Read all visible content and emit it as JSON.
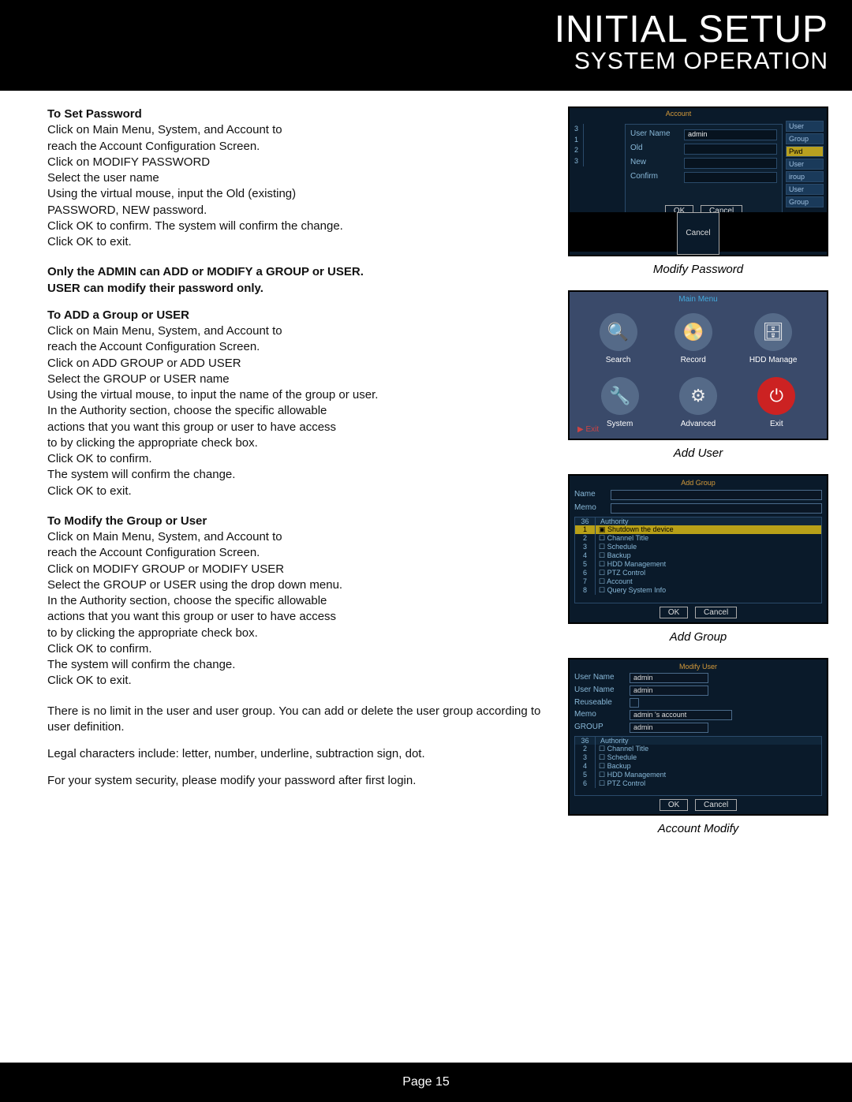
{
  "header": {
    "title": "INITIAL SETUP",
    "subtitle": "SYSTEM OPERATION"
  },
  "footer": {
    "page_label": "Page  15"
  },
  "captions": {
    "modify_password": "Modify Password",
    "add_user": "Add User",
    "add_group": "Add Group",
    "account_modify": "Account Modify"
  },
  "sections": {
    "set_password": {
      "heading": "To Set Password",
      "lines": [
        "Click on Main Menu, System, and Account to",
        "reach the Account Configuration Screen.",
        "Click on MODIFY PASSWORD",
        "Select the user name",
        "Using the virtual mouse, input the Old (existing)",
        "PASSWORD, NEW password.",
        "Click OK to confirm. The system will confirm the change.",
        "Click OK to exit."
      ]
    },
    "note1": "Only the ADMIN can ADD or MODIFY a GROUP or USER.",
    "note2": "USER can modify their password only.",
    "add_group_user": {
      "heading": "To ADD a Group or USER",
      "lines": [
        "Click on Main Menu, System, and Account to",
        "reach the Account Configuration Screen.",
        "Click on ADD GROUP or ADD USER",
        "Select the GROUP or USER name",
        "Using the virtual mouse, to input the name of the group or user.",
        "In the Authority section, choose the specific allowable",
        "actions that you want this group or user  to have access",
        "to by clicking the appropriate check box.",
        "Click OK to confirm.",
        "The system will confirm the change.",
        "Click OK to exit."
      ]
    },
    "modify_group_user": {
      "heading": "To Modify the Group or User",
      "lines": [
        "Click on Main Menu, System, and Account to",
        "reach the Account Configuration Screen.",
        "Click on MODIFY GROUP or MODIFY USER",
        "Select the GROUP or USER using the drop down menu.",
        "In the Authority section, choose the specific allowable",
        "actions that you want this group or user  to have access",
        "to by clicking the appropriate check box.",
        "Click OK to confirm.",
        "The system will confirm the change.",
        "Click OK to exit."
      ]
    },
    "para_limit": "There is no limit in the user and user group. You can add or delete the user group according to user definition.",
    "para_legal": "Legal characters include: letter, number, underline, subtraction sign, dot.",
    "para_security": "For your system security, please modify your password after first login."
  },
  "ss1": {
    "account": "Account",
    "side": [
      "User",
      "Group",
      "Pwd",
      "User",
      "iroup",
      "User",
      "Group"
    ],
    "nums": [
      "3",
      "1",
      "2",
      "3"
    ],
    "rows": {
      "username": {
        "label": "User Name",
        "value": "admin"
      },
      "old": {
        "label": "Old"
      },
      "new": {
        "label": "New"
      },
      "confirm": {
        "label": "Confirm"
      }
    },
    "ok": "OK",
    "cancel": "Cancel",
    "cancel2": "Cancel"
  },
  "ss2": {
    "title": "Main Menu",
    "icons": {
      "search": "Search",
      "record": "Record",
      "hdd": "HDD Manage",
      "system": "System",
      "advanced": "Advanced",
      "exit": "Exit"
    },
    "exit_link": "Exit"
  },
  "ss3": {
    "title": "Add Group",
    "name": "Name",
    "memo": "Memo",
    "authority": "Authority",
    "count": "36",
    "rows": [
      {
        "n": "1",
        "t": "Shutdown the device",
        "hl": true
      },
      {
        "n": "2",
        "t": "Channel Title"
      },
      {
        "n": "3",
        "t": "Schedule"
      },
      {
        "n": "4",
        "t": "Backup"
      },
      {
        "n": "5",
        "t": "HDD Management"
      },
      {
        "n": "6",
        "t": "PTZ Control"
      },
      {
        "n": "7",
        "t": "Account"
      },
      {
        "n": "8",
        "t": "Query System Info"
      }
    ],
    "ok": "OK",
    "cancel": "Cancel"
  },
  "ss4": {
    "title": "Modify User",
    "username1": {
      "label": "User Name",
      "value": "admin"
    },
    "username2": {
      "label": "User Name",
      "value": "admin"
    },
    "reusable": "Reuseable",
    "memo": {
      "label": "Memo",
      "value": "admin 's account"
    },
    "group": {
      "label": "GROUP",
      "value": "admin"
    },
    "authority": "Authority",
    "count": "36",
    "rows": [
      {
        "n": "2",
        "t": "Channel Title"
      },
      {
        "n": "3",
        "t": "Schedule"
      },
      {
        "n": "4",
        "t": "Backup"
      },
      {
        "n": "5",
        "t": "HDD Management"
      },
      {
        "n": "6",
        "t": "PTZ Control"
      }
    ],
    "ok": "OK",
    "cancel": "Cancel"
  }
}
